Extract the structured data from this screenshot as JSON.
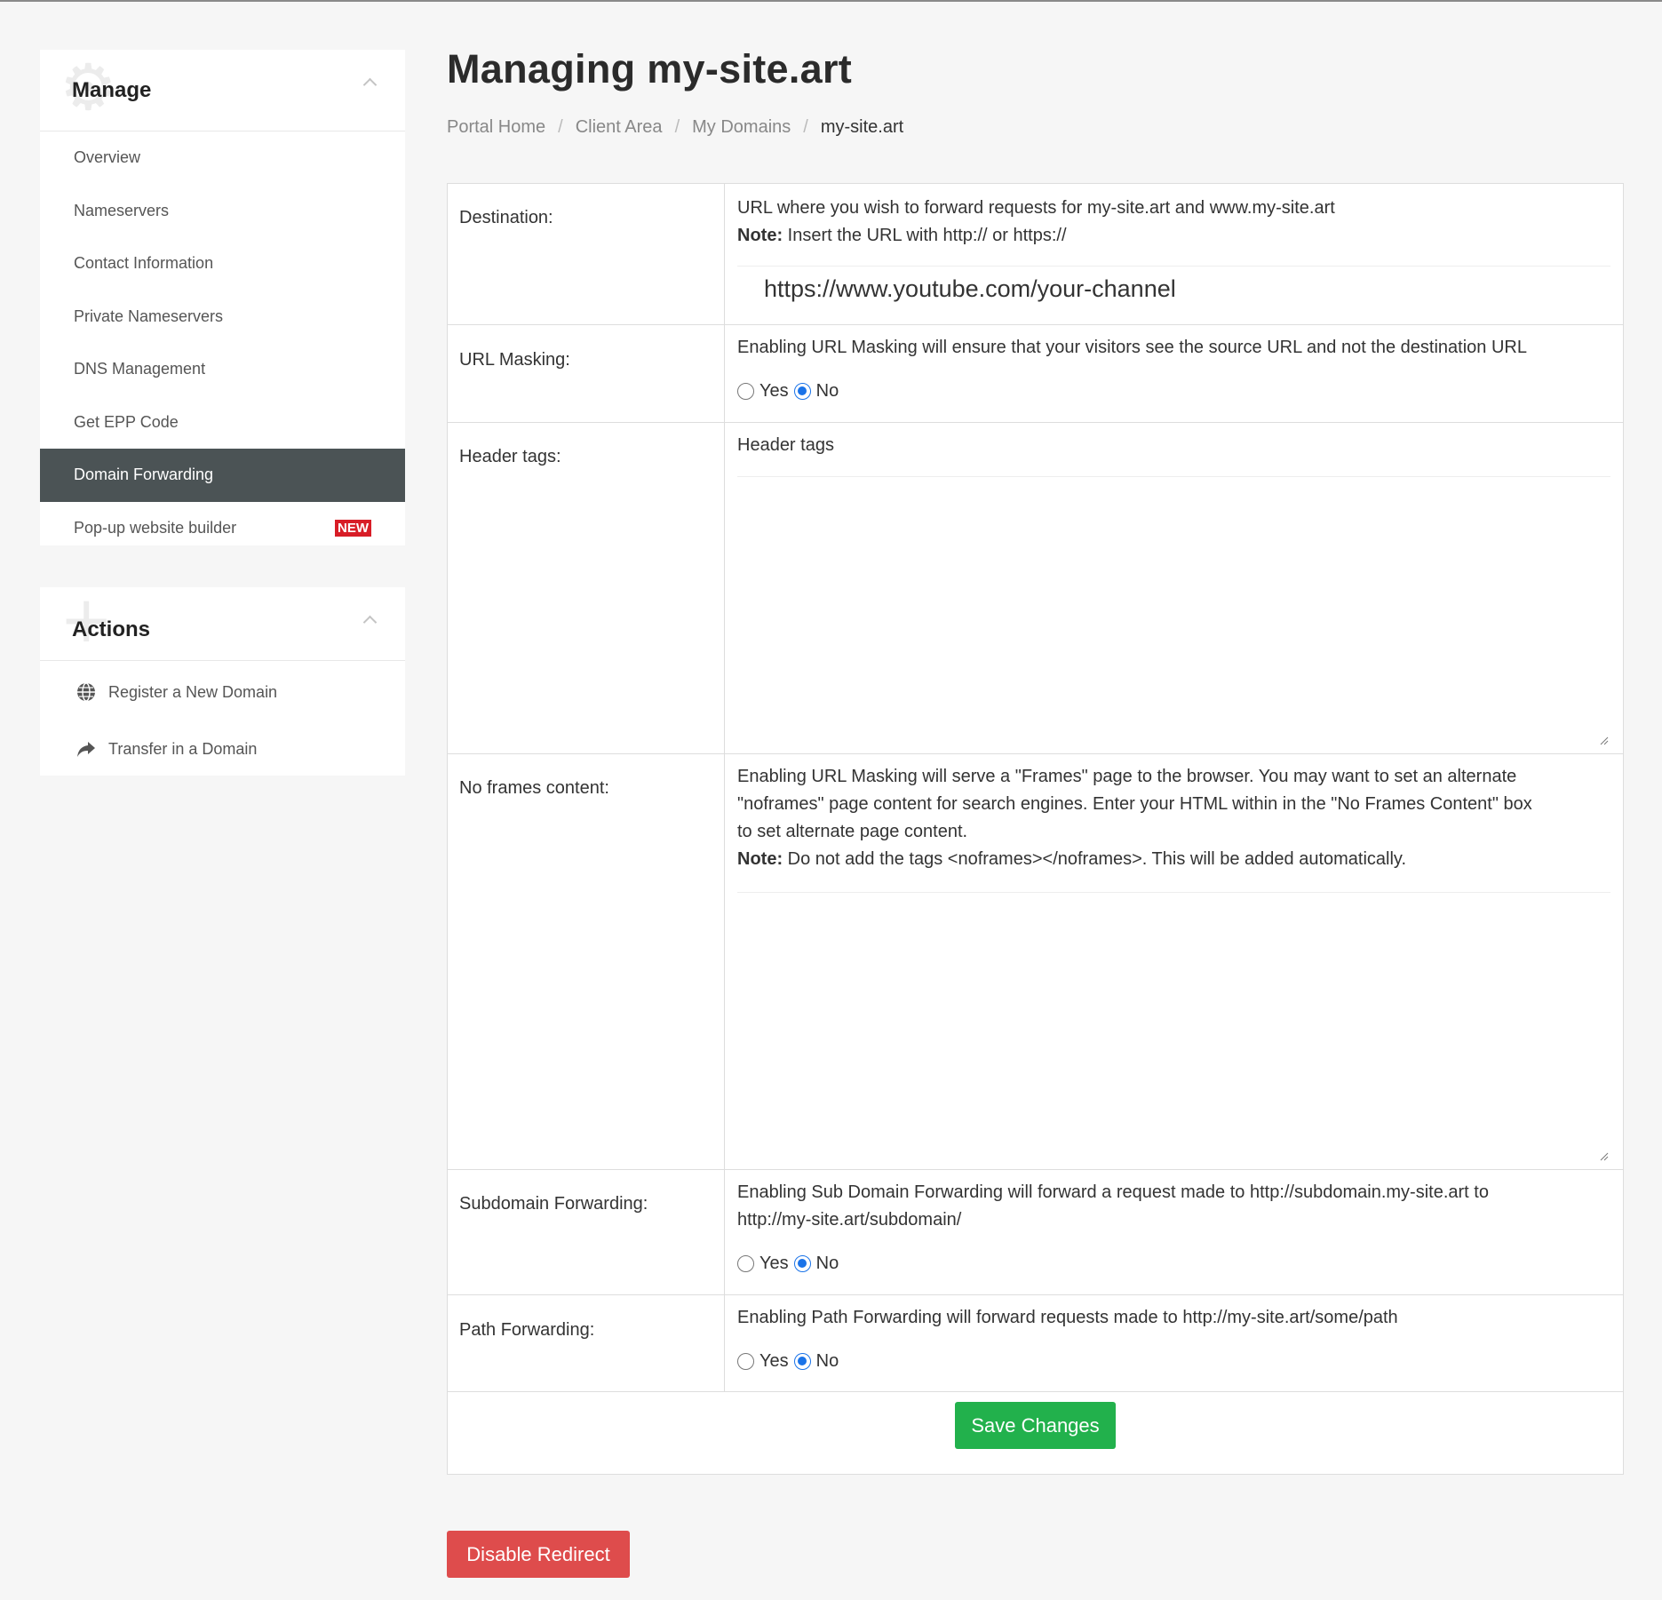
{
  "page": {
    "title": "Managing my-site.art",
    "breadcrumb": [
      {
        "label": "Portal Home"
      },
      {
        "label": "Client Area"
      },
      {
        "label": "My Domains"
      },
      {
        "label": "my-site.art"
      }
    ]
  },
  "sidebar": {
    "manage": {
      "title": "Manage",
      "items": [
        {
          "label": "Overview"
        },
        {
          "label": "Nameservers"
        },
        {
          "label": "Contact Information"
        },
        {
          "label": "Private Nameservers"
        },
        {
          "label": "DNS Management"
        },
        {
          "label": "Get EPP Code"
        },
        {
          "label": "Domain Forwarding",
          "active": true
        },
        {
          "label": "Pop-up website builder",
          "badge": "NEW"
        }
      ]
    },
    "actions": {
      "title": "Actions",
      "items": [
        {
          "label": "Register a New Domain",
          "icon": "globe-icon"
        },
        {
          "label": "Transfer in a Domain",
          "icon": "share-arrow-icon"
        }
      ]
    }
  },
  "form": {
    "destination": {
      "label": "Destination:",
      "desc": "URL where you wish to forward requests for my-site.art and www.my-site.art",
      "note_label": "Note:",
      "note_text": " Insert the URL with http:// or https://",
      "value": "https://www.youtube.com/your-channel"
    },
    "url_masking": {
      "label": "URL Masking:",
      "desc": "Enabling URL Masking will ensure that your visitors see the source URL and not the destination URL",
      "yes": "Yes",
      "no": "No",
      "selected": "No"
    },
    "header_tags": {
      "label": "Header tags:",
      "desc": "Header tags",
      "value": ""
    },
    "no_frames": {
      "label": "No frames content:",
      "desc_1": "Enabling URL Masking will serve a \"Frames\" page to the browser. You may want to set an alternate",
      "desc_2": "\"noframes\" page content for search engines. Enter your HTML within in the \"No Frames Content\" box",
      "desc_3": "to set alternate page content.",
      "note_label": "Note:",
      "note_text": " Do not add the tags <noframes></noframes>. This will be added automatically.",
      "value": ""
    },
    "subdomain_forwarding": {
      "label": "Subdomain Forwarding:",
      "desc_1": "Enabling Sub Domain Forwarding will forward a request made to http://subdomain.my-site.art to",
      "desc_2": "http://my-site.art/subdomain/",
      "yes": "Yes",
      "no": "No",
      "selected": "No"
    },
    "path_forwarding": {
      "label": "Path Forwarding:",
      "desc": "Enabling Path Forwarding will forward requests made to http://my-site.art/some/path",
      "yes": "Yes",
      "no": "No",
      "selected": "No"
    },
    "save_label": "Save Changes"
  },
  "disable_label": "Disable Redirect",
  "colors": {
    "active_nav": "#4b5355",
    "save_button": "#22b14c",
    "disable_button": "#de4c4c",
    "new_badge": "#d81d27",
    "radio_checked": "#1a73e8"
  }
}
